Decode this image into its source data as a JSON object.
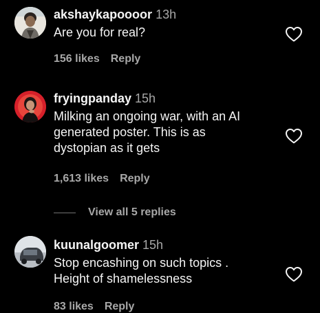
{
  "comments": [
    {
      "username": "akshaykapoooor",
      "time": "13h",
      "text": "Are you for real?",
      "likes": "156 likes",
      "reply_label": "Reply"
    },
    {
      "username": "fryingpanday",
      "time": "15h",
      "text": "Milking an ongoing war, with an AI\ngenerated poster. This is as\ndystopian as it gets",
      "likes": "1,613 likes",
      "reply_label": "Reply",
      "view_replies_label": "View all 5 replies"
    },
    {
      "username": "kuunalgoomer",
      "time": "15h",
      "text": "Stop encashing on such topics .\nHeight of shamelessness",
      "likes": "83 likes",
      "reply_label": "Reply"
    }
  ],
  "colors": {
    "background": "#000000",
    "primary_text": "#f5f5f5",
    "secondary_text": "#a8a8a8",
    "avatar_ring_red": "#d6202a"
  },
  "icons": {
    "like": "heart-outline-icon"
  }
}
